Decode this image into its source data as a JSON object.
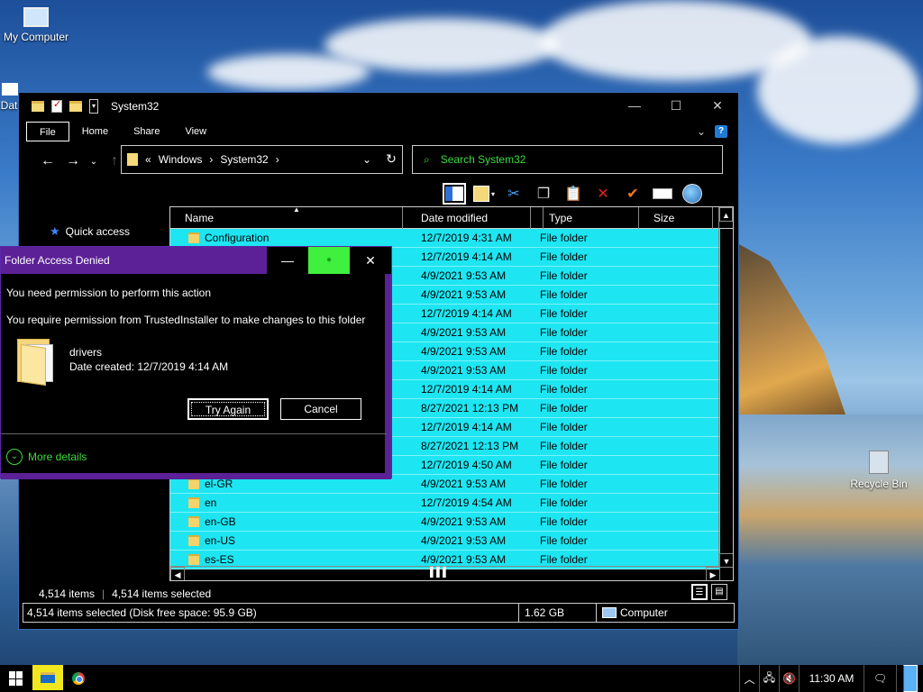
{
  "desktop": {
    "icons": [
      {
        "label": "My Computer"
      },
      {
        "label": "Dat"
      },
      {
        "label": "Recycle Bin"
      }
    ]
  },
  "explorer": {
    "title": "System32",
    "ribbon_tabs": [
      "File",
      "Home",
      "Share",
      "View"
    ],
    "address": {
      "prefix": "«",
      "crumbs": [
        "Windows",
        "System32"
      ]
    },
    "search_placeholder": "Search System32",
    "nav": {
      "quick_access": "Quick access"
    },
    "columns": [
      "Name",
      "Date modified",
      "Type",
      "Size"
    ],
    "rows": [
      {
        "name": "Configuration",
        "date": "12/7/2019 4:31 AM",
        "type": "File folder"
      },
      {
        "name": "",
        "date": "12/7/2019 4:14 AM",
        "type": "File folder"
      },
      {
        "name": "",
        "date": "4/9/2021 9:53 AM",
        "type": "File folder"
      },
      {
        "name": "",
        "date": "4/9/2021 9:53 AM",
        "type": "File folder"
      },
      {
        "name": "",
        "date": "12/7/2019 4:14 AM",
        "type": "File folder"
      },
      {
        "name": "",
        "date": "4/9/2021 9:53 AM",
        "type": "File folder"
      },
      {
        "name": "",
        "date": "4/9/2021 9:53 AM",
        "type": "File folder"
      },
      {
        "name": "",
        "date": "4/9/2021 9:53 AM",
        "type": "File folder"
      },
      {
        "name": "",
        "date": "12/7/2019 4:14 AM",
        "type": "File folder"
      },
      {
        "name": "",
        "date": "8/27/2021 12:13 PM",
        "type": "File folder"
      },
      {
        "name": "",
        "date": "12/7/2019 4:14 AM",
        "type": "File folder"
      },
      {
        "name": "",
        "date": "8/27/2021 12:13 PM",
        "type": "File folder"
      },
      {
        "name": "",
        "date": "12/7/2019 4:50 AM",
        "type": "File folder"
      },
      {
        "name": "el-GR",
        "date": "4/9/2021 9:53 AM",
        "type": "File folder"
      },
      {
        "name": "en",
        "date": "12/7/2019 4:54 AM",
        "type": "File folder"
      },
      {
        "name": "en-GB",
        "date": "4/9/2021 9:53 AM",
        "type": "File folder"
      },
      {
        "name": "en-US",
        "date": "4/9/2021 9:53 AM",
        "type": "File folder"
      },
      {
        "name": "es-ES",
        "date": "4/9/2021 9:53 AM",
        "type": "File folder"
      }
    ],
    "status": {
      "items": "4,514 items",
      "selected": "4,514 items selected",
      "detail": "4,514 items selected (Disk free space: 95.9 GB)",
      "size": "1.62 GB",
      "location": "Computer"
    },
    "toolbar_icons": [
      "preview-pane-icon",
      "properties-icon",
      "cut-icon",
      "copy-icon",
      "paste-icon",
      "delete-icon",
      "checkmark-icon",
      "rename-icon",
      "globe-icon"
    ]
  },
  "dialog": {
    "title": "Folder Access Denied",
    "message1": "You need permission to perform this action",
    "message2": "You require permission from TrustedInstaller to make changes to this folder",
    "folder_name": "drivers",
    "date_created": "Date created: 12/7/2019 4:14 AM",
    "try_again": "Try Again",
    "cancel": "Cancel",
    "more_details": "More details"
  },
  "taskbar": {
    "clock": "11:30 AM"
  },
  "colors": {
    "selection": "#1de6f2",
    "dialog_accent": "#5c2196",
    "green_text": "#3ddc3d"
  }
}
